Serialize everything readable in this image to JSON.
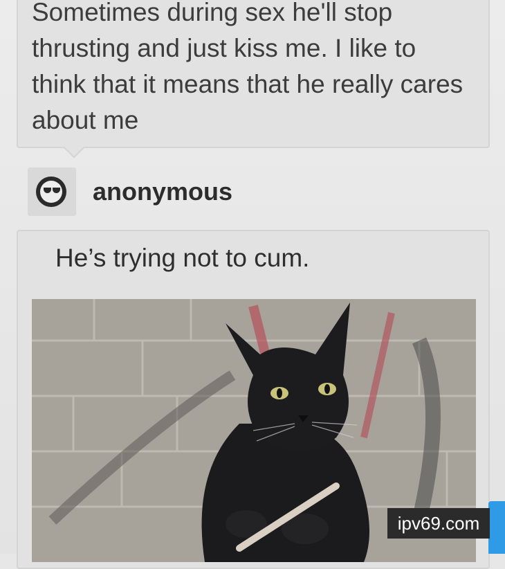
{
  "question": {
    "text": "Sometimes during sex he'll stop thrusting and just kiss me. I like to think that it means that he really cares about me"
  },
  "asker": {
    "username": "anonymous",
    "avatar_icon": "sunglasses-avatar-icon"
  },
  "answer": {
    "text": "He’s trying not to cum.",
    "image_alt": "black cat holding a nail file"
  },
  "watermark": {
    "text": "ipv69.com"
  },
  "colors": {
    "card_bg": "#e2e2e2",
    "page_bg": "#e7e7e7",
    "text": "#3c3c3c",
    "accent_blue": "#2f9be6",
    "watermark_bg": "#2b2b2b"
  }
}
